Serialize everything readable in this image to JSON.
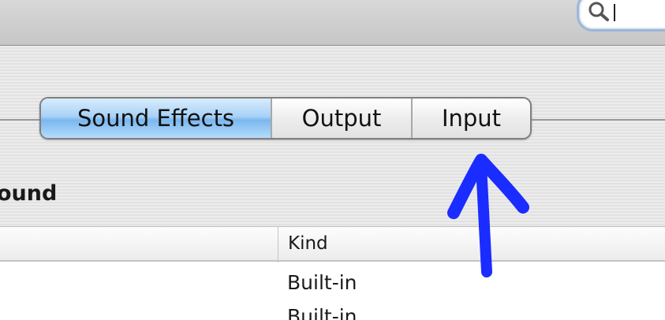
{
  "toolbar": {
    "search": {
      "icon": "magnifier-icon",
      "value": ""
    }
  },
  "tabs": [
    {
      "label": "Sound Effects",
      "selected": true
    },
    {
      "label": "Output",
      "selected": false
    },
    {
      "label": "Input",
      "selected": false
    }
  ],
  "section": {
    "title": "ound"
  },
  "table": {
    "columns": [
      "",
      "Kind"
    ],
    "rows": [
      {
        "kind": "Built-in"
      },
      {
        "kind": "Built-in"
      }
    ]
  },
  "colors": {
    "selected_tab": "#a9d2f7",
    "annotation": "#1a2cff"
  }
}
